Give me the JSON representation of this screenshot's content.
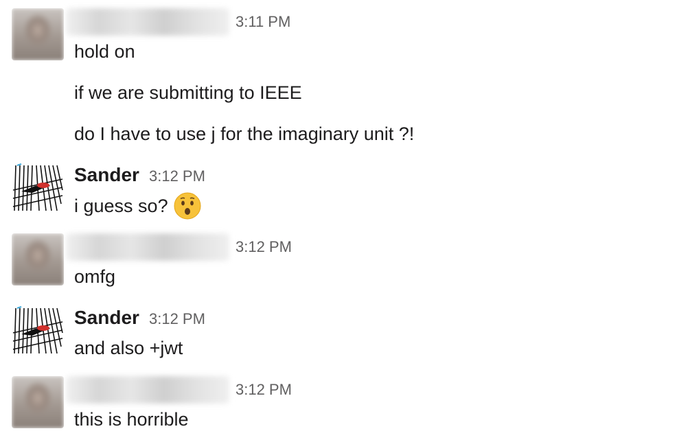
{
  "messages": [
    {
      "sender": "",
      "sender_hidden": true,
      "time": "3:11 PM",
      "lines": [
        "hold on",
        "if we are submitting to IEEE",
        "do I have to use j for the imaginary unit ?!"
      ]
    },
    {
      "sender": "Sander",
      "time": "3:12 PM",
      "lines": [
        "i guess so?"
      ],
      "emoji": "hushed-face-emoji"
    },
    {
      "sender": "",
      "sender_hidden": true,
      "time": "3:12 PM",
      "lines": [
        "omfg"
      ]
    },
    {
      "sender": "Sander",
      "time": "3:12 PM",
      "lines": [
        "and also +jwt"
      ]
    },
    {
      "sender": "",
      "sender_hidden": true,
      "time": "3:12 PM",
      "lines": [
        "this is horrible"
      ]
    }
  ],
  "colors": {
    "text": "#1d1c1d",
    "timestamp": "#616061",
    "emoji_face": "#f7c23a",
    "avatar_accent": "#d0312d"
  }
}
